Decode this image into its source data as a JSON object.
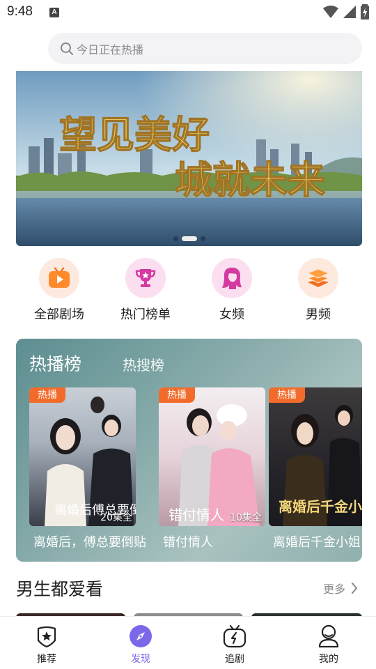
{
  "status_bar": {
    "time": "9:48",
    "notification_glyph": "A"
  },
  "search": {
    "placeholder": "今日正在热播"
  },
  "banner": {
    "line1": "望见美好",
    "line2": "城就未来",
    "active_dot": 1,
    "dot_count": 3
  },
  "categories": [
    {
      "label": "全部剧场",
      "icon": "tv-icon"
    },
    {
      "label": "热门榜单",
      "icon": "trophy-icon"
    },
    {
      "label": "女频",
      "icon": "woman-icon"
    },
    {
      "label": "男频",
      "icon": "layers-icon"
    }
  ],
  "hot_board": {
    "tabs": [
      "热播榜",
      "热搜榜"
    ],
    "items": [
      {
        "badge": "热播",
        "episodes": "20集全",
        "title": "离婚后，傅总要倒贴",
        "poster_text": "离婚后傅总要倒贴"
      },
      {
        "badge": "热播",
        "episodes": "10集全",
        "title": "错付情人",
        "poster_text": "错付情人"
      },
      {
        "badge": "热播",
        "episodes": "",
        "title": "离婚后千金小姐",
        "poster_text": "离婚后千金小姐"
      }
    ]
  },
  "section": {
    "title": "男生都爱看",
    "more": "更多"
  },
  "bottom_nav": [
    {
      "label": "推荐",
      "icon": "badge-star-icon",
      "active": false
    },
    {
      "label": "发现",
      "icon": "compass-icon",
      "active": true
    },
    {
      "label": "追剧",
      "icon": "tv-follow-icon",
      "active": false
    },
    {
      "label": "我的",
      "icon": "profile-icon",
      "active": false
    }
  ],
  "colors": {
    "accent": "#7a68e8",
    "badge": "#f26b2a"
  }
}
